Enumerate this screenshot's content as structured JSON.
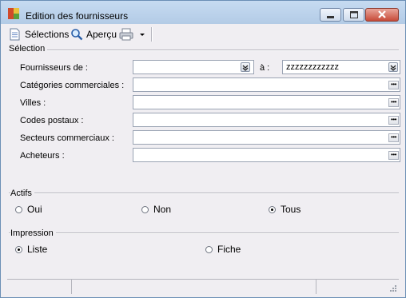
{
  "window": {
    "title": "Edition des fournisseurs"
  },
  "toolbar": {
    "selections_label": "Sélections",
    "apercu_label": "Aperçu"
  },
  "selection": {
    "group_label": "Sélection",
    "fournisseurs_label": "Fournisseurs de :",
    "a_label": "à :",
    "fournisseurs_from_value": "",
    "fournisseurs_to_value": "zzzzzzzzzzzz",
    "rows": [
      {
        "label": "Catégories commerciales :",
        "value": ""
      },
      {
        "label": "Villes :",
        "value": ""
      },
      {
        "label": "Codes postaux :",
        "value": ""
      },
      {
        "label": "Secteurs commerciaux :",
        "value": ""
      },
      {
        "label": "Acheteurs :",
        "value": ""
      }
    ]
  },
  "actifs": {
    "label": "Actifs",
    "options": [
      "Oui",
      "Non",
      "Tous"
    ],
    "selected": "Tous"
  },
  "impression": {
    "label": "Impression",
    "options": [
      "Liste",
      "Fiche"
    ],
    "selected": "Liste"
  },
  "colors": {
    "title_bar": "#b9d1ea",
    "close_button": "#c74a38",
    "window_bg": "#f0eef2"
  }
}
